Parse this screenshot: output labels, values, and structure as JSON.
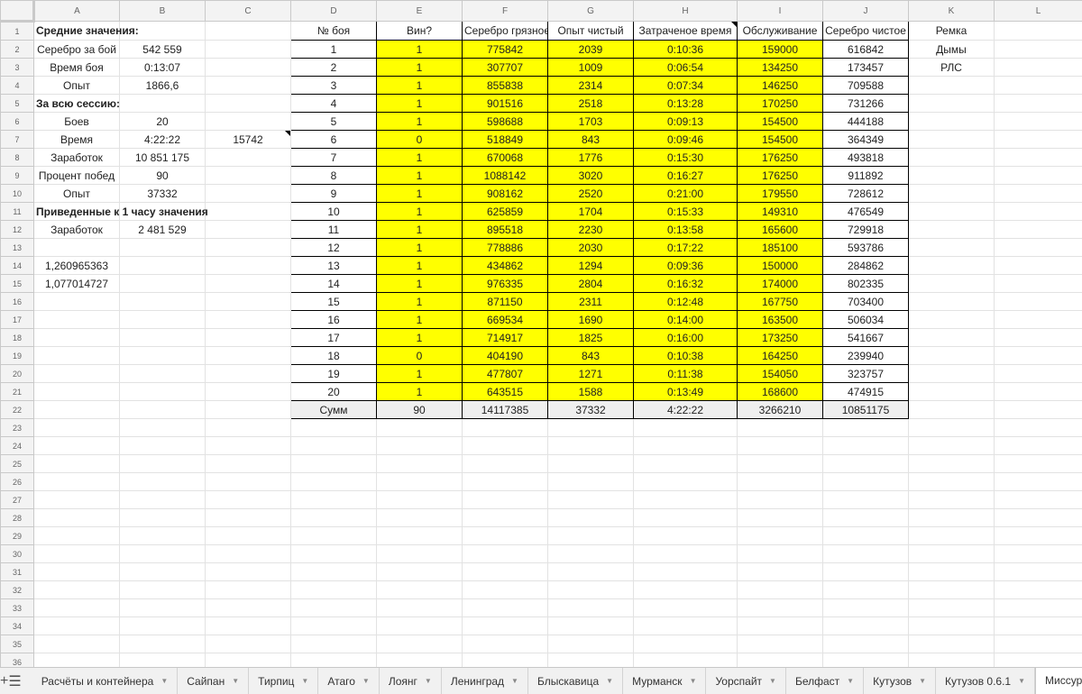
{
  "columns": [
    "A",
    "B",
    "C",
    "D",
    "E",
    "F",
    "G",
    "H",
    "I",
    "J",
    "K",
    "L"
  ],
  "rows": [
    {
      "A": "Средние значения:",
      "D": "№ боя",
      "E": "Вин?",
      "F": "Серебро грязное",
      "G": "Опыт чистый",
      "H": "Затраченое время",
      "I": "Обслуживание",
      "J": "Серебро чистое",
      "K": "Ремка"
    },
    {
      "A": "Серебро за бой",
      "B": "542 559",
      "D": "1",
      "E": "1",
      "F": "775842",
      "G": "2039",
      "H": "0:10:36",
      "I": "159000",
      "J": "616842",
      "K": "Дымы"
    },
    {
      "A": "Время боя",
      "B": "0:13:07",
      "D": "2",
      "E": "1",
      "F": "307707",
      "G": "1009",
      "H": "0:06:54",
      "I": "134250",
      "J": "173457",
      "K": "РЛС"
    },
    {
      "A": "Опыт",
      "B": "1866,6",
      "D": "3",
      "E": "1",
      "F": "855838",
      "G": "2314",
      "H": "0:07:34",
      "I": "146250",
      "J": "709588"
    },
    {
      "A": "За всю сессию:",
      "D": "4",
      "E": "1",
      "F": "901516",
      "G": "2518",
      "H": "0:13:28",
      "I": "170250",
      "J": "731266"
    },
    {
      "A": "Боев",
      "B": "20",
      "D": "5",
      "E": "1",
      "F": "598688",
      "G": "1703",
      "H": "0:09:13",
      "I": "154500",
      "J": "444188"
    },
    {
      "A": "Время",
      "B": "4:22:22",
      "C": "15742",
      "D": "6",
      "E": "0",
      "F": "518849",
      "G": "843",
      "H": "0:09:46",
      "I": "154500",
      "J": "364349"
    },
    {
      "A": "Заработок",
      "B": "10 851 175",
      "D": "7",
      "E": "1",
      "F": "670068",
      "G": "1776",
      "H": "0:15:30",
      "I": "176250",
      "J": "493818"
    },
    {
      "A": "Процент побед",
      "B": "90",
      "D": "8",
      "E": "1",
      "F": "1088142",
      "G": "3020",
      "H": "0:16:27",
      "I": "176250",
      "J": "911892"
    },
    {
      "A": "Опыт",
      "B": "37332",
      "D": "9",
      "E": "1",
      "F": "908162",
      "G": "2520",
      "H": "0:21:00",
      "I": "179550",
      "J": "728612"
    },
    {
      "A": "Приведенные к 1 часу значения",
      "D": "10",
      "E": "1",
      "F": "625859",
      "G": "1704",
      "H": "0:15:33",
      "I": "149310",
      "J": "476549"
    },
    {
      "A": "Заработок",
      "B": "2 481 529",
      "D": "11",
      "E": "1",
      "F": "895518",
      "G": "2230",
      "H": "0:13:58",
      "I": "165600",
      "J": "729918"
    },
    {
      "D": "12",
      "E": "1",
      "F": "778886",
      "G": "2030",
      "H": "0:17:22",
      "I": "185100",
      "J": "593786"
    },
    {
      "A": "1,260965363",
      "D": "13",
      "E": "1",
      "F": "434862",
      "G": "1294",
      "H": "0:09:36",
      "I": "150000",
      "J": "284862"
    },
    {
      "A": "1,077014727",
      "D": "14",
      "E": "1",
      "F": "976335",
      "G": "2804",
      "H": "0:16:32",
      "I": "174000",
      "J": "802335"
    },
    {
      "D": "15",
      "E": "1",
      "F": "871150",
      "G": "2311",
      "H": "0:12:48",
      "I": "167750",
      "J": "703400"
    },
    {
      "D": "16",
      "E": "1",
      "F": "669534",
      "G": "1690",
      "H": "0:14:00",
      "I": "163500",
      "J": "506034"
    },
    {
      "D": "17",
      "E": "1",
      "F": "714917",
      "G": "1825",
      "H": "0:16:00",
      "I": "173250",
      "J": "541667"
    },
    {
      "D": "18",
      "E": "0",
      "F": "404190",
      "G": "843",
      "H": "0:10:38",
      "I": "164250",
      "J": "239940"
    },
    {
      "D": "19",
      "E": "1",
      "F": "477807",
      "G": "1271",
      "H": "0:11:38",
      "I": "154050",
      "J": "323757"
    },
    {
      "D": "20",
      "E": "1",
      "F": "643515",
      "G": "1588",
      "H": "0:13:49",
      "I": "168600",
      "J": "474915"
    },
    {
      "D": "Сумм",
      "E": "90",
      "F": "14117385",
      "G": "37332",
      "H": "4:22:22",
      "I": "3266210",
      "J": "10851175"
    },
    {},
    {},
    {},
    {},
    {},
    {},
    {},
    {},
    {},
    {},
    {},
    {},
    {},
    {}
  ],
  "tabs": [
    "Расчёты и контейнера",
    "Сайпан",
    "Тирпиц",
    "Атаго",
    "Лоянг",
    "Ленинград",
    "Блыскавица",
    "Мурманск",
    "Уорспайт",
    "Белфаст",
    "Кутузов",
    "Кутузов 0.6.1",
    "Миссури"
  ],
  "active_tab": "Миссури",
  "icons": {
    "add_sheet": "plus-icon",
    "all_sheets": "list-icon"
  },
  "colors": {
    "highlight": "#ffff00",
    "sum_row": "#efefef",
    "header_bg": "#f3f3f3"
  }
}
